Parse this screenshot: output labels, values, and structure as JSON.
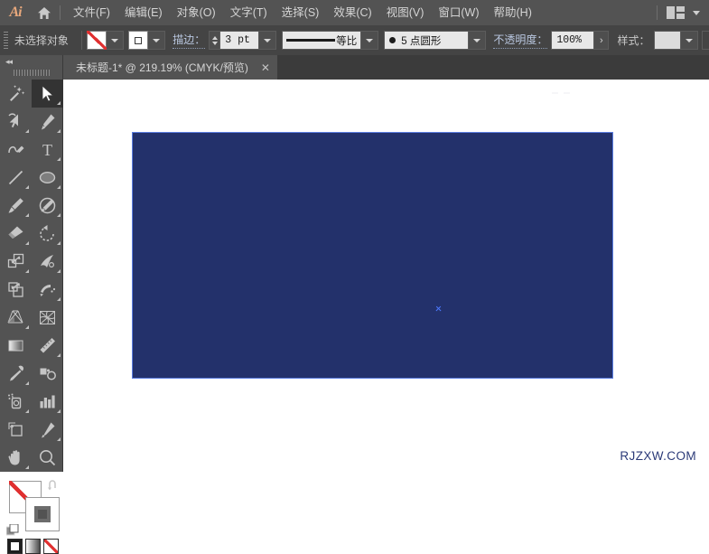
{
  "app": {
    "name": "Ai",
    "logo_color": "#e8a87c"
  },
  "menubar": {
    "home_icon": "home-icon",
    "items": [
      {
        "label": "文件(F)",
        "name": "menu-file"
      },
      {
        "label": "编辑(E)",
        "name": "menu-edit"
      },
      {
        "label": "对象(O)",
        "name": "menu-object"
      },
      {
        "label": "文字(T)",
        "name": "menu-type"
      },
      {
        "label": "选择(S)",
        "name": "menu-select"
      },
      {
        "label": "效果(C)",
        "name": "menu-effect"
      },
      {
        "label": "视图(V)",
        "name": "menu-view"
      },
      {
        "label": "窗口(W)",
        "name": "menu-window"
      },
      {
        "label": "帮助(H)",
        "name": "menu-help"
      }
    ],
    "arrange_icon": "arrange-documents-icon",
    "arrange_chevron": "chevron-down-icon"
  },
  "optionsbar": {
    "selection_label": "未选择对象",
    "fill_swatch": "none-fill-swatch",
    "fill_chevron": "chevron-down-icon",
    "stroke_swatch": "stroke-color-swatch",
    "stroke_chevron": "chevron-down-icon",
    "stroke_label": "描边：",
    "stroke_weight": "3 pt",
    "weight_chevron": "chevron-down-icon",
    "profile_label": "等比",
    "profile_chevron": "chevron-down-icon",
    "brush_label": "5 点圆形",
    "brush_chevron": "chevron-down-icon",
    "opacity_label": "不透明度：",
    "opacity_value": "100%",
    "opacity_arrow": "›",
    "style_label": "样式：",
    "style_chevron": "chevron-down-icon"
  },
  "tabbar": {
    "document_title": "未标题-1* @ 219.19% (CMYK/预览)",
    "close_glyph": "✕"
  },
  "toolbar": {
    "collapse_glyph": "◂◂",
    "grip": "panel-grip",
    "tools": [
      {
        "name": "magic-wand-tool",
        "active": false,
        "more": false
      },
      {
        "name": "selection-tool",
        "active": true,
        "more": true
      },
      {
        "name": "direct-selection-tool",
        "active": false,
        "more": true
      },
      {
        "name": "pen-tool",
        "active": false,
        "more": true
      },
      {
        "name": "curvature-tool",
        "active": false,
        "more": false
      },
      {
        "name": "type-tool",
        "active": false,
        "more": true
      },
      {
        "name": "line-segment-tool",
        "active": false,
        "more": true
      },
      {
        "name": "ellipse-tool",
        "active": false,
        "more": true
      },
      {
        "name": "paintbrush-tool",
        "active": false,
        "more": true
      },
      {
        "name": "shaper-tool",
        "active": false,
        "more": true
      },
      {
        "name": "eraser-tool",
        "active": false,
        "more": true
      },
      {
        "name": "rotate-tool",
        "active": false,
        "more": true
      },
      {
        "name": "scale-tool",
        "active": false,
        "more": true
      },
      {
        "name": "width-tool",
        "active": false,
        "more": true
      },
      {
        "name": "free-transform-tool",
        "active": false,
        "more": false
      },
      {
        "name": "shape-builder-tool",
        "active": false,
        "more": true
      },
      {
        "name": "perspective-grid-tool",
        "active": false,
        "more": true
      },
      {
        "name": "mesh-tool",
        "active": false,
        "more": false
      },
      {
        "name": "gradient-tool",
        "active": false,
        "more": false
      },
      {
        "name": "measure-tool",
        "active": false,
        "more": true
      },
      {
        "name": "eyedropper-tool",
        "active": false,
        "more": true
      },
      {
        "name": "blend-tool",
        "active": false,
        "more": false
      },
      {
        "name": "symbol-sprayer-tool",
        "active": false,
        "more": true
      },
      {
        "name": "column-graph-tool",
        "active": false,
        "more": true
      },
      {
        "name": "artboard-tool",
        "active": false,
        "more": false
      },
      {
        "name": "slice-tool",
        "active": false,
        "more": true
      },
      {
        "name": "hand-tool",
        "active": false,
        "more": true
      },
      {
        "name": "zoom-tool",
        "active": false,
        "more": false
      }
    ],
    "fill_swatch": "fill-none-swatch",
    "stroke_swatch": "stroke-gray-swatch",
    "swap_icon": "swap-fill-stroke-icon",
    "default_icon": "default-fill-stroke-icon",
    "modes": [
      {
        "name": "color-mode-button"
      },
      {
        "name": "gradient-mode-button"
      },
      {
        "name": "none-mode-button"
      }
    ]
  },
  "canvas": {
    "artboard_fill": "#23316b",
    "artboard_border": "#5b7de0",
    "center_marker": "artboard-center-marker",
    "watermark": "RJZXW.COM"
  }
}
